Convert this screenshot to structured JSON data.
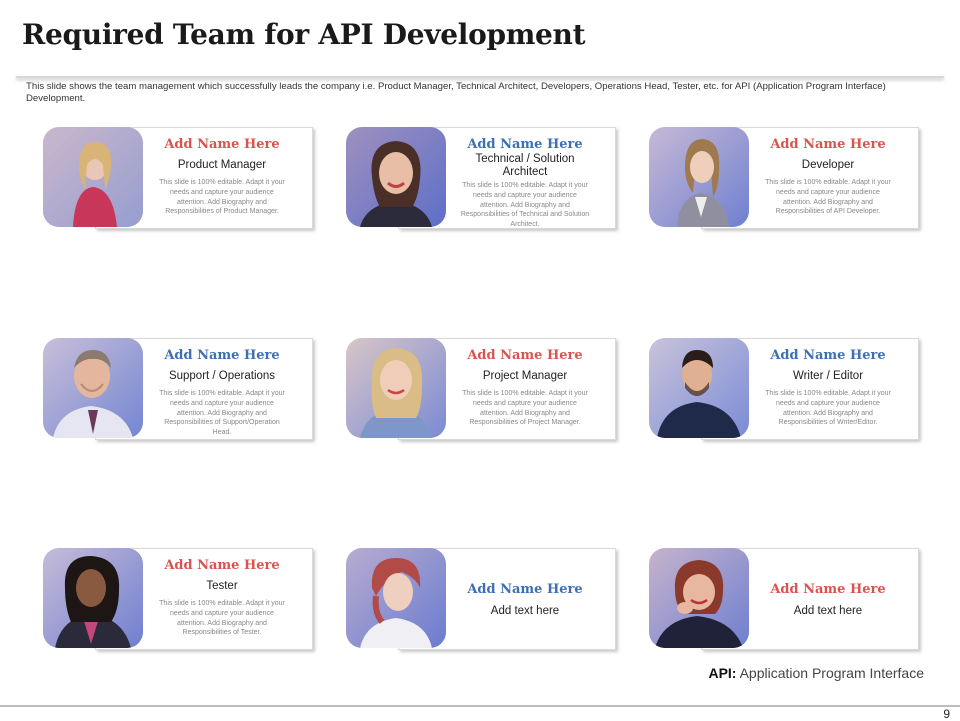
{
  "slide": {
    "title": "Required Team for API Development",
    "description": "This slide shows the team management  which successfully leads the company i.e. Product Manager, Technical Architect, Developers, Operations Head, Tester, etc. for API (Application Program Interface) Development.",
    "footnote_label": "API:",
    "footnote_text": " Application Program Interface",
    "page_number": "9"
  },
  "cards": [
    {
      "name": "Add Name Here",
      "role": "Product Manager",
      "bio": "This slide is 100% editable. Adapt it your needs and capture your audience attention. Add Biography and Responsibilities of Product Manager.",
      "name_color": "#d9534f"
    },
    {
      "name": "Add Name Here",
      "role": "Technical / Solution Architect",
      "bio": "This slide is 100% editable. Adapt it your needs and capture your audience attention. Add Biography and Responsibilities of Technical and Solution Architect.",
      "name_color": "#3d6fb4"
    },
    {
      "name": "Add Name Here",
      "role": "Developer",
      "bio": "This slide is 100% editable. Adapt it your needs and capture your audience attention. Add Biography and Responsibilities of API Developer.",
      "name_color": "#d9534f"
    },
    {
      "name": "Add Name Here",
      "role": "Support / Operations",
      "bio": "This slide is 100% editable. Adapt it your needs and capture your audience attention. Add Biography and Responsibilities of Support/Operation Head.",
      "name_color": "#3d6fb4"
    },
    {
      "name": "Add Name Here",
      "role": "Project Manager",
      "bio": "This slide is 100% editable. Adapt it your needs and capture your audience attention. Add Biography and Responsibilities of Project Manager.",
      "name_color": "#d9534f"
    },
    {
      "name": "Add Name Here",
      "role": "Writer / Editor",
      "bio": "This slide is 100% editable. Adapt it your needs and capture your audience attention. Add Biography and Responsibilities of Writer/Editor.",
      "name_color": "#3d6fb4"
    },
    {
      "name": "Add Name Here",
      "role": "Tester",
      "bio": "This slide is 100% editable. Adapt it your needs and capture your audience attention. Add Biography and Responsibilities of Tester.",
      "name_color": "#d9534f"
    },
    {
      "name": "Add Name Here",
      "role": "Add text here",
      "bio": "",
      "name_color": "#3d6fb4"
    },
    {
      "name": "Add Name Here",
      "role": "Add text here",
      "bio": "",
      "name_color": "#d9534f"
    }
  ]
}
